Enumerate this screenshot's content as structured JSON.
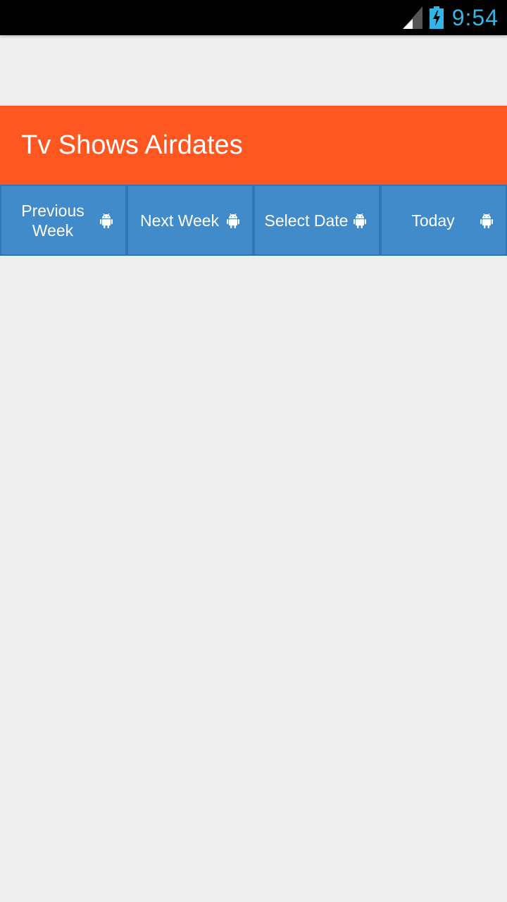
{
  "status_bar": {
    "time": "9:54",
    "icons": [
      "signal-icon",
      "battery-charging-icon"
    ],
    "time_color": "#33b5e5"
  },
  "header": {
    "title": "Tv Shows Airdates",
    "background_color": "#ff5722"
  },
  "buttons": [
    {
      "label": "Previous Week",
      "icon": "android-icon"
    },
    {
      "label": "Next Week",
      "icon": "android-icon"
    },
    {
      "label": "Select Date",
      "icon": "android-icon"
    },
    {
      "label": "Today",
      "icon": "android-icon"
    }
  ],
  "button_color": "#428bca"
}
